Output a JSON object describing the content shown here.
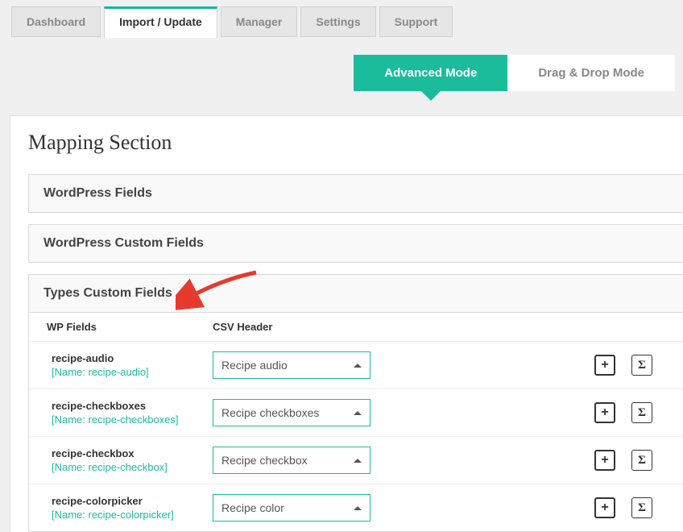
{
  "tabs": {
    "dashboard": "Dashboard",
    "import": "Import / Update",
    "manager": "Manager",
    "settings": "Settings",
    "support": "Support"
  },
  "modes": {
    "advanced": "Advanced Mode",
    "dragdrop": "Drag & Drop Mode"
  },
  "mapping": {
    "title": "Mapping Section",
    "acc_wp_fields": "WordPress Fields",
    "acc_wp_custom": "WordPress Custom Fields",
    "acc_types_custom": "Types Custom Fields",
    "col_wp": "WP Fields",
    "col_csv": "CSV Header",
    "rows": [
      {
        "field": "recipe-audio",
        "name": "[Name: recipe-audio]",
        "csv": "Recipe audio"
      },
      {
        "field": "recipe-checkboxes",
        "name": "[Name: recipe-checkboxes]",
        "csv": "Recipe checkboxes"
      },
      {
        "field": "recipe-checkbox",
        "name": "[Name: recipe-checkbox]",
        "csv": "Recipe checkbox"
      },
      {
        "field": "recipe-colorpicker",
        "name": "[Name: recipe-colorpicker]",
        "csv": "Recipe color"
      }
    ]
  }
}
